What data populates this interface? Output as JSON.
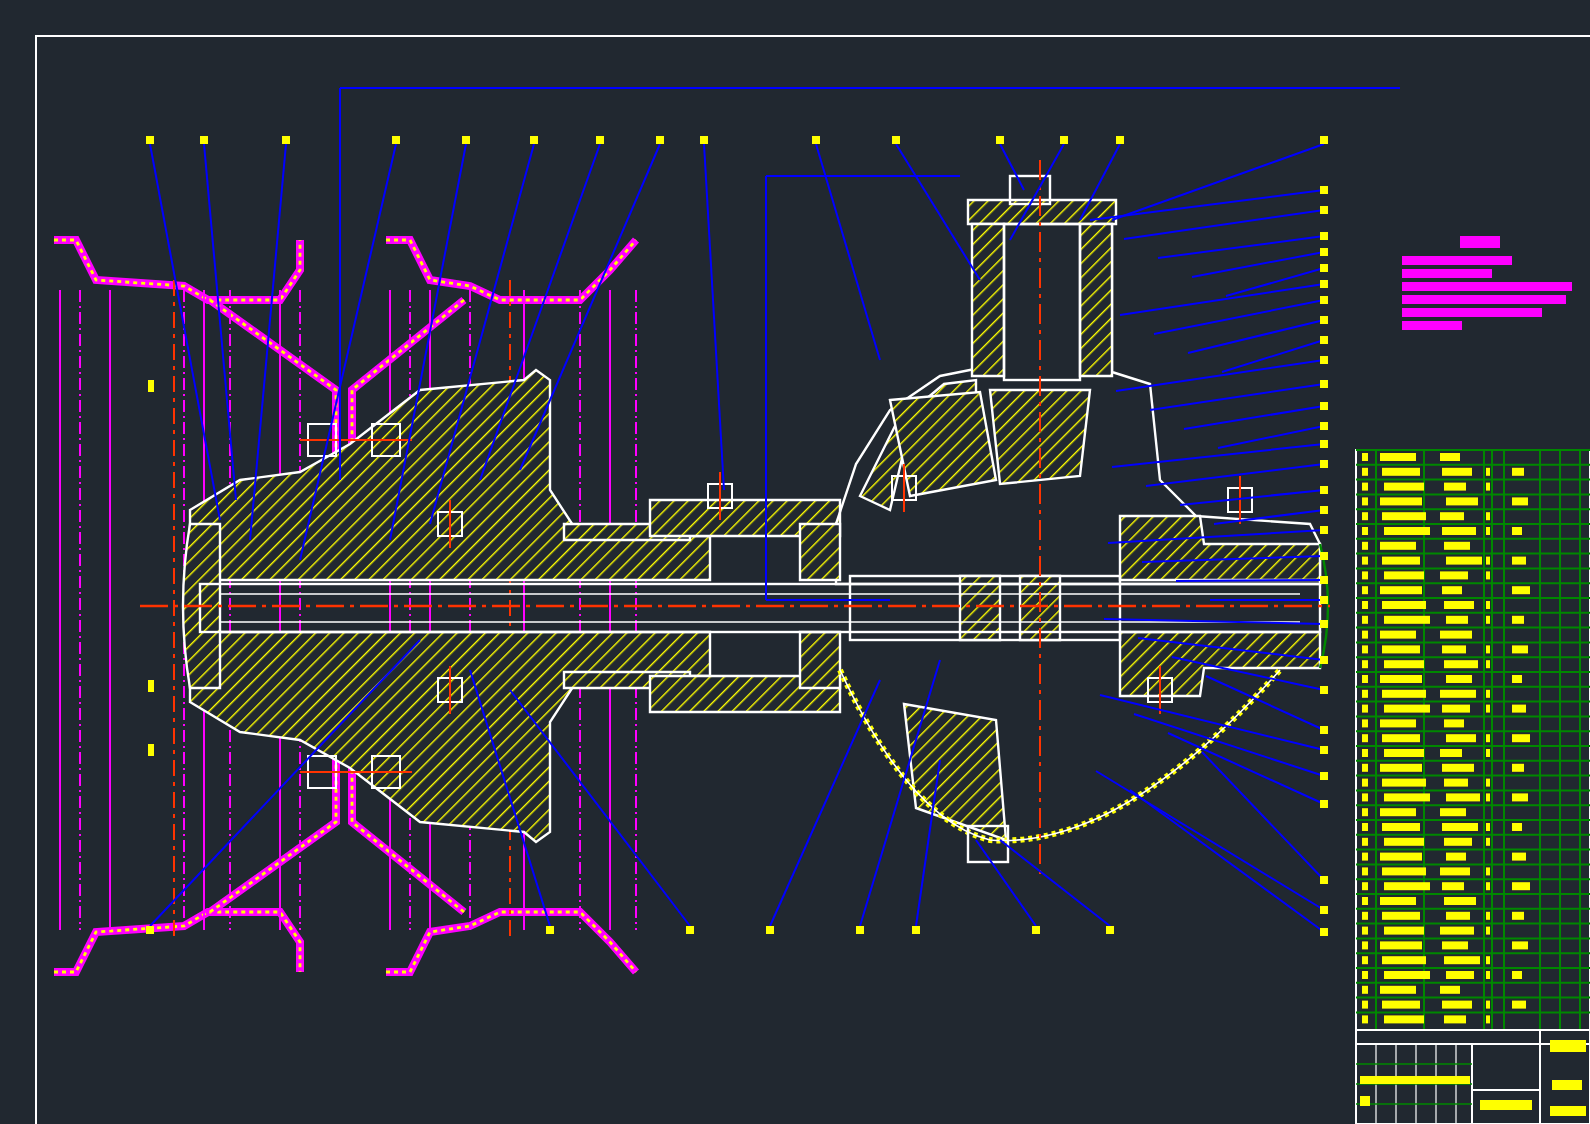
{
  "sheet": {
    "kind": "assembly-drawing"
  }
}
